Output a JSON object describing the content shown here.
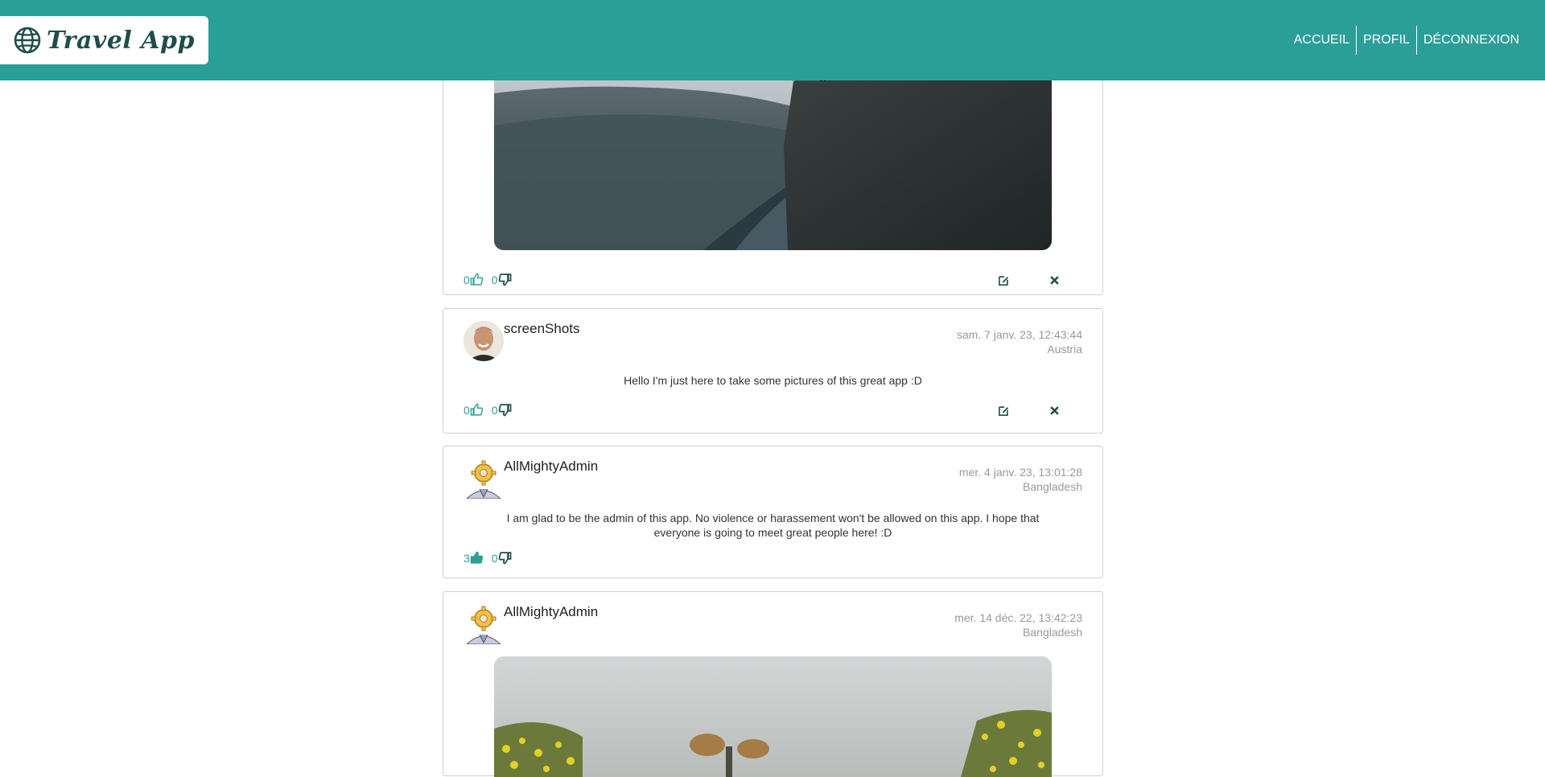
{
  "app": {
    "brand": "Travel App"
  },
  "nav": {
    "links": [
      "ACCUEIL",
      "PROFIL",
      "DÉCONNEXION"
    ]
  },
  "colors": {
    "primary": "#2a9f97",
    "dark": "#1f4d4a"
  },
  "posts": [
    {
      "type": "image",
      "image": "fjord-cliff-photo",
      "likes": "0",
      "dislikes": "0",
      "can_edit": true
    },
    {
      "author": "screenShots",
      "date": "sam. 7 janv. 23, 12:43:44",
      "country": "Austria",
      "text": "Hello I'm just here to take some pictures of this great app :D",
      "likes": "0",
      "dislikes": "0",
      "can_edit": true,
      "avatar": "man-portrait-avatar"
    },
    {
      "author": "AllMightyAdmin",
      "date": "mer. 4 janv. 23, 13:01:28",
      "country": "Bangladesh",
      "text_line1": "I am glad to be the admin of this app. No violence or harassement won't be allowed on this app. I hope that",
      "text_line2": "everyone is going to meet great people here! :D",
      "likes": "3",
      "dislikes": "0",
      "can_edit": false,
      "avatar": "admin-gear-avatar"
    },
    {
      "author": "AllMightyAdmin",
      "date": "mer. 14 déc. 22, 13:42:23",
      "country": "Bangladesh",
      "image": "flower-field-photo",
      "avatar": "admin-gear-avatar"
    }
  ],
  "icons": {
    "like": "thumbs-up-icon",
    "dislike": "thumbs-down-icon",
    "edit": "edit-icon",
    "delete": "close-icon"
  }
}
